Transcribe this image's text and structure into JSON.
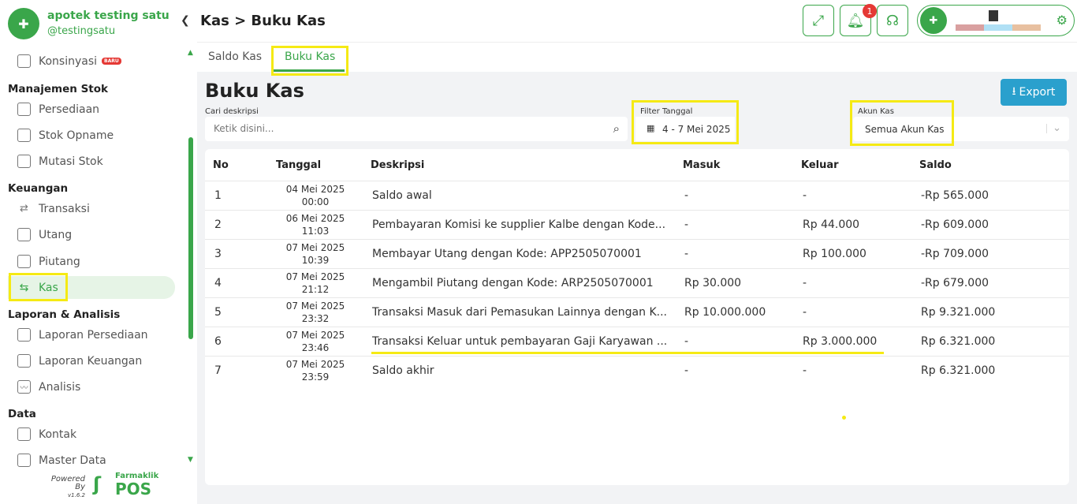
{
  "brand": {
    "name": "apotek testing satu",
    "username": "@testingsatu"
  },
  "sidebar": {
    "konsinyasi": "Konsinyasi",
    "konsinyasi_badge": "BARU",
    "sections": {
      "stok": "Manajemen Stok",
      "keuangan": "Keuangan",
      "laporan": "Laporan & Analisis",
      "data": "Data"
    },
    "items": {
      "persediaan": "Persediaan",
      "stok_opname": "Stok Opname",
      "mutasi_stok": "Mutasi Stok",
      "transaksi": "Transaksi",
      "utang": "Utang",
      "piutang": "Piutang",
      "kas": "Kas",
      "laporan_persediaan": "Laporan Persediaan",
      "laporan_keuangan": "Laporan Keuangan",
      "analisis": "Analisis",
      "kontak": "Kontak",
      "master_data": "Master Data"
    },
    "powered_by": "Powered By",
    "version": "v1.6.2",
    "footer_brand": "Farmaklik",
    "footer_product": "POS"
  },
  "header": {
    "title": "Kas > Buku Kas",
    "notification_count": "1"
  },
  "tabs": {
    "saldo_kas": "Saldo Kas",
    "buku_kas": "Buku Kas"
  },
  "main": {
    "heading": "Buku Kas",
    "export_label": "Export",
    "search": {
      "label": "Cari deskripsi",
      "placeholder": "Ketik disini..."
    },
    "date_filter": {
      "label": "Filter Tanggal",
      "value": "4 - 7 Mei 2025"
    },
    "akun_kas": {
      "label": "Akun Kas",
      "value": "Semua Akun Kas"
    }
  },
  "table": {
    "headers": {
      "no": "No",
      "tanggal": "Tanggal",
      "deskripsi": "Deskripsi",
      "masuk": "Masuk",
      "keluar": "Keluar",
      "saldo": "Saldo"
    },
    "rows": [
      {
        "no": "1",
        "date": "04 Mei 2025",
        "time": "00:00",
        "desc": "Saldo awal",
        "masuk": "-",
        "keluar": "-",
        "saldo": "-Rp 565.000"
      },
      {
        "no": "2",
        "date": "06 Mei 2025",
        "time": "11:03",
        "desc": "Pembayaran Komisi ke supplier Kalbe dengan Kode...",
        "masuk": "-",
        "keluar": "Rp 44.000",
        "saldo": "-Rp 609.000"
      },
      {
        "no": "3",
        "date": "07 Mei 2025",
        "time": "10:39",
        "desc": "Membayar Utang dengan Kode: APP2505070001",
        "masuk": "-",
        "keluar": "Rp 100.000",
        "saldo": "-Rp 709.000"
      },
      {
        "no": "4",
        "date": "07 Mei 2025",
        "time": "21:12",
        "desc": "Mengambil Piutang dengan Kode: ARP2505070001",
        "masuk": "Rp 30.000",
        "keluar": "-",
        "saldo": "-Rp 679.000"
      },
      {
        "no": "5",
        "date": "07 Mei 2025",
        "time": "23:32",
        "desc": "Transaksi Masuk dari Pemasukan Lainnya dengan K...",
        "masuk": "Rp 10.000.000",
        "keluar": "-",
        "saldo": "Rp 9.321.000"
      },
      {
        "no": "6",
        "date": "07 Mei 2025",
        "time": "23:46",
        "desc": "Transaksi Keluar untuk pembayaran Gaji Karyawan ...",
        "masuk": "-",
        "keluar": "Rp 3.000.000",
        "saldo": "Rp 6.321.000"
      },
      {
        "no": "7",
        "date": "07 Mei 2025",
        "time": "23:59",
        "desc": "Saldo akhir",
        "masuk": "-",
        "keluar": "-",
        "saldo": "Rp 6.321.000"
      }
    ]
  },
  "colors": {
    "brand_green": "#3aa64a",
    "export_blue": "#2aa0cd",
    "highlight_yellow": "#f5ea14",
    "badge_red": "#e53935"
  }
}
